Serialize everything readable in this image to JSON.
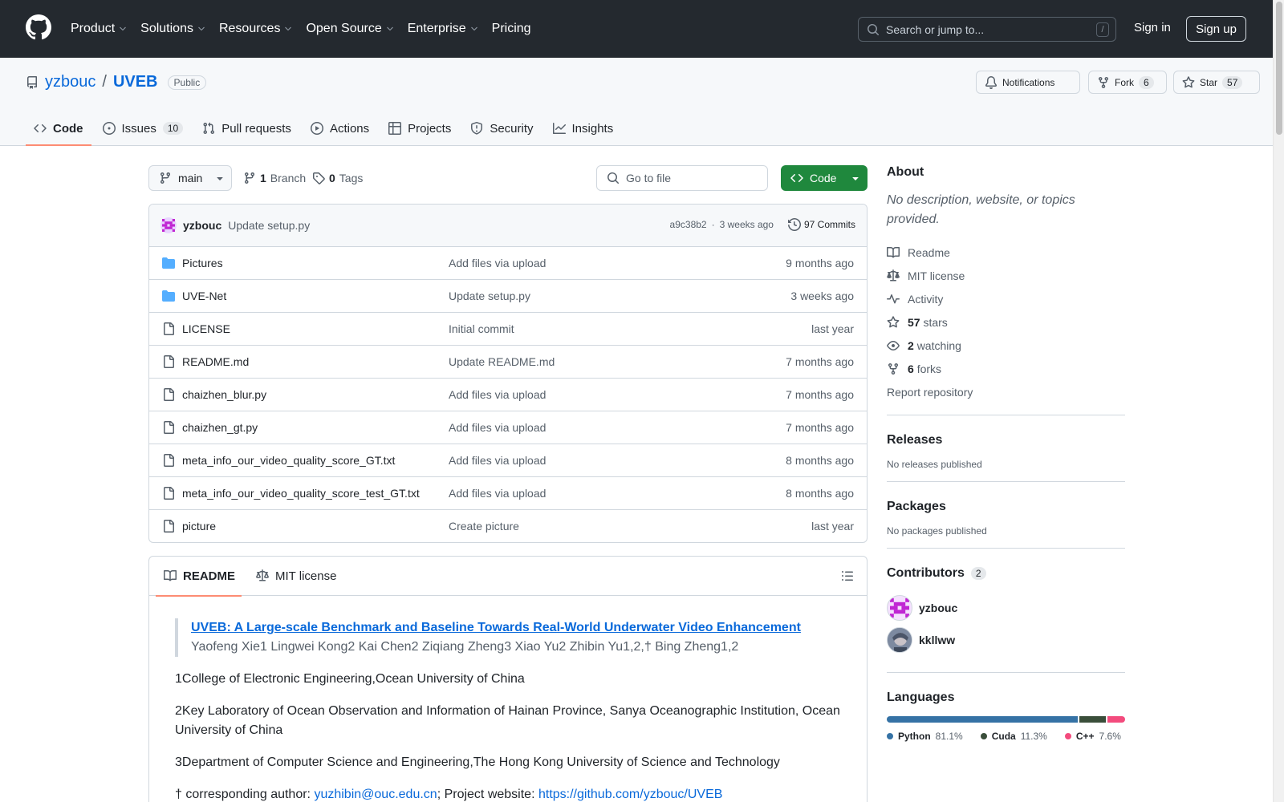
{
  "header": {
    "nav": [
      "Product",
      "Solutions",
      "Resources",
      "Open Source",
      "Enterprise",
      "Pricing"
    ],
    "search_placeholder": "Search or jump to...",
    "search_shortcut": "/",
    "sign_in": "Sign in",
    "sign_up": "Sign up"
  },
  "repo": {
    "owner": "yzbouc",
    "separator": "/",
    "name": "UVEB",
    "visibility": "Public",
    "notifications": "Notifications",
    "fork_label": "Fork",
    "fork_count": "6",
    "star_label": "Star",
    "star_count": "57"
  },
  "tabs": {
    "code": "Code",
    "issues": "Issues",
    "issues_count": "10",
    "pulls": "Pull requests",
    "actions": "Actions",
    "projects": "Projects",
    "security": "Security",
    "insights": "Insights"
  },
  "toolbar": {
    "branch": "main",
    "branch_count": "1",
    "branch_label": "Branch",
    "tag_count": "0",
    "tag_label": "Tags",
    "goto_placeholder": "Go to file",
    "code_button": "Code"
  },
  "commit": {
    "author": "yzbouc",
    "message": "Update setup.py",
    "hash": "a9c38b2",
    "dot": "·",
    "age": "3 weeks ago",
    "commits": "97 Commits"
  },
  "files": [
    {
      "name": "Pictures",
      "type": "dir",
      "message": "Add files via upload",
      "age": "9 months ago"
    },
    {
      "name": "UVE-Net",
      "type": "dir",
      "message": "Update setup.py",
      "age": "3 weeks ago"
    },
    {
      "name": "LICENSE",
      "type": "file",
      "message": "Initial commit",
      "age": "last year"
    },
    {
      "name": "README.md",
      "type": "file",
      "message": "Update README.md",
      "age": "7 months ago"
    },
    {
      "name": "chaizhen_blur.py",
      "type": "file",
      "message": "Add files via upload",
      "age": "7 months ago"
    },
    {
      "name": "chaizhen_gt.py",
      "type": "file",
      "message": "Add files via upload",
      "age": "7 months ago"
    },
    {
      "name": "meta_info_our_video_quality_score_GT.txt",
      "type": "file",
      "message": "Add files via upload",
      "age": "8 months ago"
    },
    {
      "name": "meta_info_our_video_quality_score_test_GT.txt",
      "type": "file",
      "message": "Add files via upload",
      "age": "8 months ago"
    },
    {
      "name": "picture",
      "type": "file",
      "message": "Create picture",
      "age": "last year"
    }
  ],
  "readme": {
    "tab_readme": "README",
    "tab_license": "MIT license",
    "title_link": "UVEB: A Large-scale Benchmark and Baseline Towards Real-World Underwater Video Enhancement",
    "authors": "Yaofeng Xie1 Lingwei Kong2 Kai Chen2 Ziqiang Zheng3 Xiao Yu2 Zhibin Yu1,2,† Bing Zheng1,2",
    "aff1": "1College of Electronic Engineering,Ocean University of China",
    "aff2": "2Key Laboratory of Ocean Observation and Information of Hainan Province, Sanya Oceanographic Institution, Ocean University of China",
    "aff3": "3Department of Computer Science and Engineering,The Hong Kong University of Science and Technology",
    "corr_prefix": "† corresponding author: ",
    "corr_email": "yuzhibin@ouc.edu.cn",
    "corr_mid": "; Project website: ",
    "corr_site": "https://github.com/yzbouc/UVEB"
  },
  "sidebar": {
    "about_title": "About",
    "about_desc": "No description, website, or topics provided.",
    "readme": "Readme",
    "license": "MIT license",
    "activity": "Activity",
    "stars_count": "57",
    "stars_label": "stars",
    "watching_count": "2",
    "watching_label": "watching",
    "forks_count": "6",
    "forks_label": "forks",
    "report": "Report repository",
    "releases_title": "Releases",
    "releases_none": "No releases published",
    "packages_title": "Packages",
    "packages_none": "No packages published",
    "contributors_title": "Contributors",
    "contributors_count": "2",
    "contributors": [
      "yzbouc",
      "kkllww"
    ],
    "languages_title": "Languages",
    "languages": [
      {
        "name": "Python",
        "percent": "81.1%",
        "value": 81.1,
        "color": "#3572A5"
      },
      {
        "name": "Cuda",
        "percent": "11.3%",
        "value": 11.3,
        "color": "#3A4E3A"
      },
      {
        "name": "C++",
        "percent": "7.6%",
        "value": 7.6,
        "color": "#f34b7d"
      }
    ]
  }
}
